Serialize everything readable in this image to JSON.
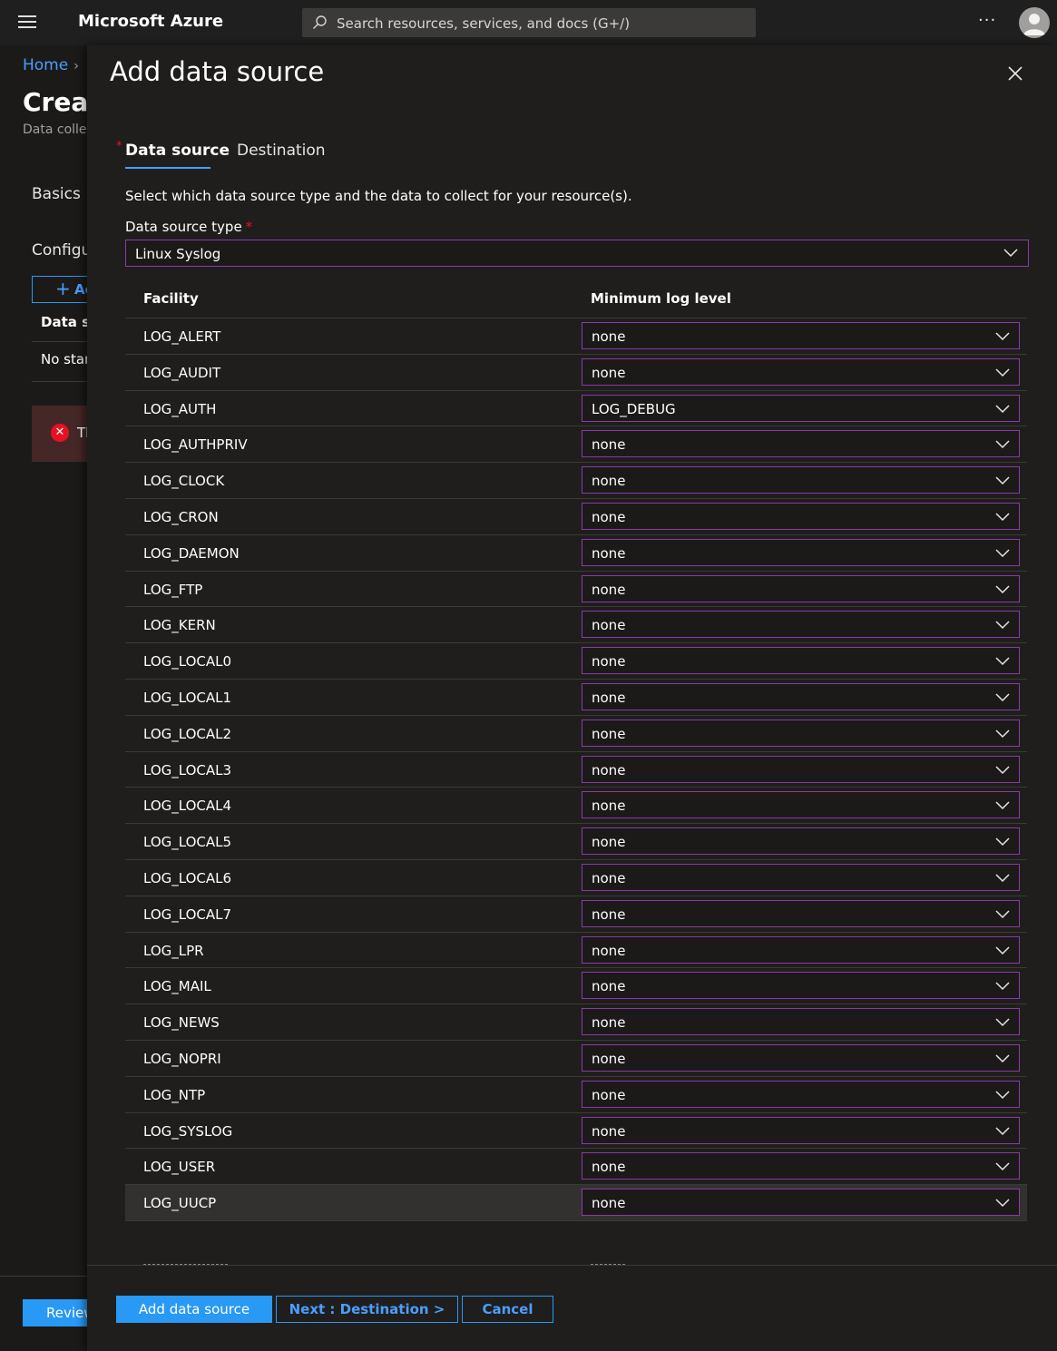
{
  "topbar": {
    "brand": "Microsoft Azure",
    "search_placeholder": "Search resources, services, and docs (G+/)",
    "more": "···"
  },
  "background": {
    "breadcrumb_home": "Home",
    "title": "Creat",
    "subtitle": "Data collec",
    "tab_basics": "Basics",
    "tab_config": "Configu",
    "add_button": "Ac",
    "col_header": "Data sc",
    "no_start": "No star",
    "error_text": "Tl",
    "review_button": "Review"
  },
  "panel": {
    "title": "Add data source",
    "tabs": {
      "data_source": "Data source",
      "destination": "Destination",
      "required_mark": "*"
    },
    "description": "Select which data source type and the data to collect for your resource(s).",
    "data_source_type_label": "Data source type",
    "data_source_type_value": "Linux Syslog",
    "table": {
      "col_facility": "Facility",
      "col_min_level": "Minimum log level",
      "rows": [
        {
          "facility": "LOG_ALERT",
          "level": "none"
        },
        {
          "facility": "LOG_AUDIT",
          "level": "none"
        },
        {
          "facility": "LOG_AUTH",
          "level": "LOG_DEBUG"
        },
        {
          "facility": "LOG_AUTHPRIV",
          "level": "none"
        },
        {
          "facility": "LOG_CLOCK",
          "level": "none"
        },
        {
          "facility": "LOG_CRON",
          "level": "none"
        },
        {
          "facility": "LOG_DAEMON",
          "level": "none"
        },
        {
          "facility": "LOG_FTP",
          "level": "none"
        },
        {
          "facility": "LOG_KERN",
          "level": "none"
        },
        {
          "facility": "LOG_LOCAL0",
          "level": "none"
        },
        {
          "facility": "LOG_LOCAL1",
          "level": "none"
        },
        {
          "facility": "LOG_LOCAL2",
          "level": "none"
        },
        {
          "facility": "LOG_LOCAL3",
          "level": "none"
        },
        {
          "facility": "LOG_LOCAL4",
          "level": "none"
        },
        {
          "facility": "LOG_LOCAL5",
          "level": "none"
        },
        {
          "facility": "LOG_LOCAL6",
          "level": "none"
        },
        {
          "facility": "LOG_LOCAL7",
          "level": "none"
        },
        {
          "facility": "LOG_LPR",
          "level": "none"
        },
        {
          "facility": "LOG_MAIL",
          "level": "none"
        },
        {
          "facility": "LOG_NEWS",
          "level": "none"
        },
        {
          "facility": "LOG_NOPRI",
          "level": "none"
        },
        {
          "facility": "LOG_NTP",
          "level": "none"
        },
        {
          "facility": "LOG_SYSLOG",
          "level": "none"
        },
        {
          "facility": "LOG_USER",
          "level": "none"
        },
        {
          "facility": "LOG_UUCP",
          "level": "none"
        }
      ]
    },
    "footer": {
      "add_button": "Add data source",
      "next_button": "Next : Destination >",
      "cancel_button": "Cancel"
    }
  },
  "colors": {
    "accent": "#2899f5",
    "link": "#4a9eff",
    "required": "#e81123",
    "dropdown_border": "#8a3aa8",
    "background": "#1b1a19"
  },
  "icons": [
    "hamburger-icon",
    "search-icon",
    "more-icon",
    "avatar",
    "close-icon",
    "chevron-down-icon",
    "error-icon",
    "plus-icon",
    "chevron-right-icon"
  ]
}
